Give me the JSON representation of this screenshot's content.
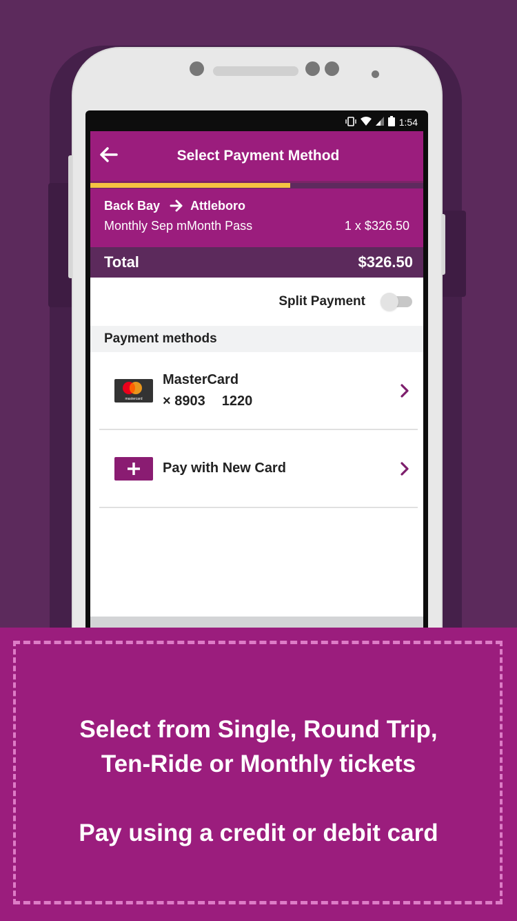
{
  "status_bar": {
    "time": "1:54",
    "battery_level": "79",
    "icons": [
      "vibrate-icon",
      "wifi-icon",
      "signal-icon",
      "battery-icon"
    ]
  },
  "app_bar": {
    "title": "Select Payment Method",
    "back_icon": "arrow-left-icon"
  },
  "progress": {
    "percent": 60,
    "fill_color": "#f6c342"
  },
  "trip": {
    "origin": "Back Bay",
    "destination": "Attleboro",
    "ticket": "Monthly Sep mMonth Pass",
    "quantity_price": "1 x $326.50"
  },
  "total": {
    "label": "Total",
    "amount": "$326.50"
  },
  "split_payment": {
    "label": "Split Payment",
    "enabled": false
  },
  "payment_methods": {
    "header": "Payment methods",
    "items": [
      {
        "type": "mastercard",
        "name": "MasterCard",
        "last4": "× 8903",
        "expiry": "1220",
        "logo_text": "mastercard"
      },
      {
        "type": "new",
        "name": "Pay with New Card",
        "icon": "plus-icon"
      }
    ]
  },
  "promo": {
    "line1": "Select from Single, Round Trip,",
    "line2": "Ten-Ride or Monthly tickets",
    "line3": "Pay using a credit or debit card"
  },
  "colors": {
    "brand": "#9b1d7d",
    "dark_brand": "#5c2a5c",
    "accent": "#f6c342"
  }
}
